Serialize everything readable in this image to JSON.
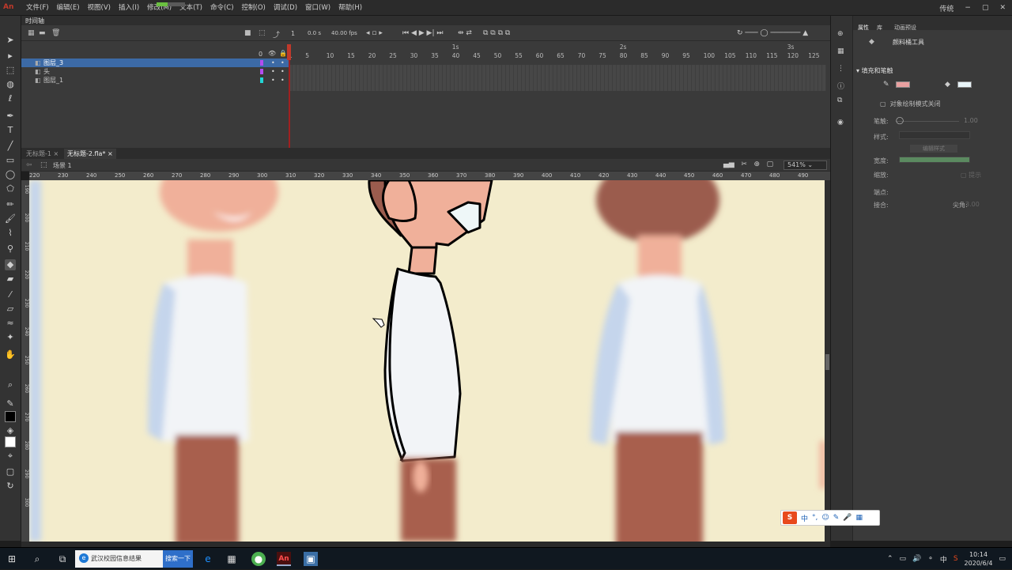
{
  "app": {
    "logo_text": "An",
    "menus": [
      "文件(F)",
      "编辑(E)",
      "视图(V)",
      "插入(I)",
      "修改(M)",
      "文本(T)",
      "命令(C)",
      "控制(O)",
      "调试(D)",
      "窗口(W)",
      "帮助(H)"
    ],
    "workspace": "传统",
    "window_controls": [
      "−",
      "▢",
      "✕"
    ]
  },
  "timeline": {
    "tab_title": "时间轴",
    "fps_value": "0.0 s",
    "zoom_value": "40.00 fps",
    "frame_start": "1",
    "ruler_numbers": [
      "1",
      "5",
      "10",
      "15",
      "20",
      "25",
      "30",
      "35",
      "40",
      "45",
      "50",
      "55",
      "60",
      "65",
      "70",
      "75",
      "80",
      "85",
      "90",
      "95",
      "100",
      "105",
      "110",
      "115",
      "120",
      "125"
    ],
    "second_marks": [
      "1s",
      "2s",
      "3s"
    ],
    "layers": [
      {
        "name": "图层_3",
        "selected": true,
        "color": "#b44cf0"
      },
      {
        "name": "头",
        "selected": false,
        "color": "#b44cf0"
      },
      {
        "name": "图层_1",
        "selected": false,
        "color": "#22d6d6"
      }
    ],
    "frame_count_label": "0"
  },
  "document": {
    "tabs": [
      {
        "label": "无标题-1",
        "active": false
      },
      {
        "label": "无标题-2.fla*",
        "active": true
      }
    ],
    "scene_label": "场景 1",
    "zoom": "541%",
    "h_ruler": [
      "220",
      "230",
      "240",
      "250",
      "260",
      "270",
      "280",
      "290",
      "300",
      "310",
      "320",
      "330",
      "340",
      "350",
      "360",
      "370",
      "380",
      "390",
      "400",
      "410",
      "420",
      "430",
      "440",
      "450",
      "460",
      "470",
      "480",
      "490"
    ],
    "v_ruler": [
      "190",
      "200",
      "210",
      "220",
      "230",
      "240",
      "250",
      "260",
      "270",
      "280",
      "290",
      "300"
    ]
  },
  "properties": {
    "tabs": [
      "属性",
      "库",
      "动画预设"
    ],
    "tool_name": "颜料桶工具",
    "section": "填充和笔触",
    "object_drawing": "对象绘制模式关闭",
    "stroke_label": "笔触:",
    "stroke_value": "1.00",
    "style_label": "样式:",
    "edit_style_btn": "编辑样式",
    "width_label": "宽度:",
    "scale_label": "缩放:",
    "hint_label": "提示",
    "cap_label": "端点:",
    "join_label": "接合:",
    "miter_label": "尖角:",
    "miter_value": "3.00",
    "fill_color": "#e8f4f8",
    "stroke_color": "#e8a0a0"
  },
  "ime": {
    "items": [
      "中",
      "°,",
      "☺",
      "✎",
      "🎤",
      "▦"
    ]
  },
  "taskbar": {
    "search_text": "武汉校园信息结果",
    "search_button": "搜索一下",
    "time": "10:14",
    "date": "2020/6/4",
    "ime_lang": "中"
  }
}
